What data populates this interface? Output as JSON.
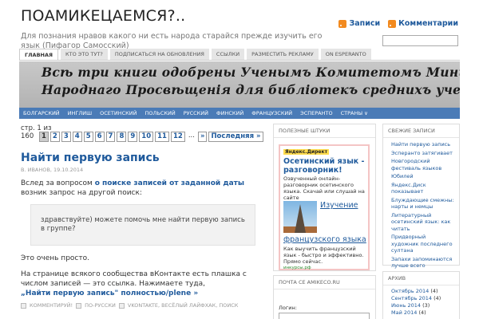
{
  "site": {
    "title": "ПОАМИКЕЦАЕМСЯ?..",
    "description": "Для познания нравов какого ни есть народа старайся прежде изучить его язык (Пифагор Самосский)",
    "feeds": {
      "posts": "Записи",
      "comments": "Комментарии",
      "icon": "rss-icon"
    },
    "search": {
      "placeholder": ""
    }
  },
  "top_nav": [
    "ГЛАВНАЯ",
    "КТО ЭТО ТУТ?",
    "ПОДПИСАТЬСЯ НА ОБНОВЛЕНИЯ",
    "ССЫЛКИ",
    "РАЗМЕСТИТЬ РЕКЛАМУ",
    "ON ESPERANTO"
  ],
  "banner": {
    "line1": "Всѣ три книги одобрены Ученымъ Комитетомъ Министерства",
    "line2": "Народнаго Просвѣщенія для библіотекъ среднихъ учебныхъ заведеній"
  },
  "lang_nav": [
    "БОЛГАРСКИЙ",
    "ИНГЛИШ",
    "ОСЕТИНСКИЙ",
    "ПОЛЬСКИЙ",
    "РУССКИЙ",
    "ФИНСКИЙ",
    "ФРАНЦУЗСКИЙ",
    "ЭСПЕРАНТО",
    "СТРАНЫ ∨"
  ],
  "pagination": {
    "info_line1": "стр. 1 из",
    "info_line2": "160",
    "pages": [
      "1",
      "2",
      "3",
      "4",
      "5",
      "6",
      "7",
      "8",
      "9",
      "10",
      "11",
      "12"
    ],
    "dots": "...",
    "next": "»",
    "last": "Последняя »",
    "current": "1"
  },
  "post": {
    "title": "Найти первую запись",
    "meta": "В. ИВАНОВ, 19.10.2014",
    "p1_before": "Вслед за вопросом ",
    "p1_link": "о поиске записей от заданной даты",
    "p1_after": " возник запрос на другой поиск:",
    "quote": "здравствуйте) можете помочь мне найти первую запись в группе?",
    "p2": "Это очень просто.",
    "p3": "На странице всякого сообщества вКонтакте есть плашка с числом записей — это ссылка. Нажимаете туда,",
    "more": "„Найти первую запись\" полностью/plene »",
    "footer": {
      "comments": "КОММЕНТИРУЙ!",
      "category": "ПО-РУССКИ",
      "tags": "VKONTAKTE, ВЕСЁЛЫЙ ЛАЙФХАК, ПОИСК"
    }
  },
  "useful": {
    "header": "ПОЛЕЗНЫЕ ШТУКИ",
    "ad_label": "Яндекс.Директ",
    "ad1": {
      "title": "Осетинский язык - разговорник!",
      "desc": "Озвученный онлайн-разговорник осетинского языка. Скачай или слушай на сайте",
      "url": "ossetny.ru"
    },
    "ad2": {
      "title_a": "Изучение",
      "title_b": "французского языка",
      "desc": "Как выучить французский язык - быстро и эффективно. Прямо сейчас.",
      "url": "инкурсы.рф"
    }
  },
  "recent": {
    "header": "СВЕЖИЕ ЗАПИСИ",
    "items": [
      "Найти первую запись",
      "Эсперанто затягивает",
      "Новгородский фестиваль языков",
      "Юбилей",
      "Яндекс.Диск показывает",
      "Блуждающие смежны: нарты и немцы",
      "Литературный осетинский язык: как читать",
      "Придворный художник последнего султана",
      "Запахи запоминаются лучше всего"
    ]
  },
  "mail": {
    "header": "ПОЧТА СЕ AMIKECO.RU",
    "login_label": "Логин:"
  },
  "archive": {
    "header": "АРХИВ",
    "items": [
      {
        "month": "Октябрь 2014",
        "count": "(4)"
      },
      {
        "month": "Сентябрь 2014",
        "count": "(4)"
      },
      {
        "month": "Июнь 2014",
        "count": "(3)"
      },
      {
        "month": "Май 2014",
        "count": "(4)"
      }
    ]
  }
}
